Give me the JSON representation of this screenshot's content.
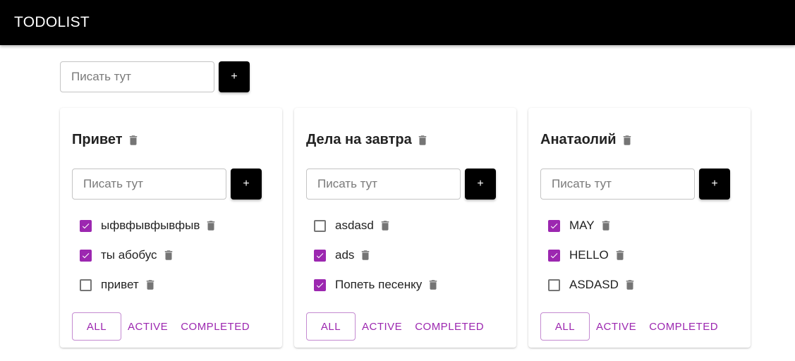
{
  "app": {
    "title": "TODOLIST"
  },
  "add_list": {
    "placeholder": "Писать тут",
    "button_label": "+"
  },
  "colors": {
    "accent": "#9c27b0",
    "appbar": "#000000",
    "icon_gray": "#757575"
  },
  "lists": [
    {
      "title": "Привет",
      "input_placeholder": "Писать тут",
      "add_label": "+",
      "tasks": [
        {
          "text": "ыфвфывфывфыв",
          "done": true
        },
        {
          "text": "ты абобус",
          "done": true
        },
        {
          "text": "привет",
          "done": false
        }
      ],
      "filters": {
        "all": "ALL",
        "active": "ACTIVE",
        "completed": "COMPLETED",
        "selected": "all"
      }
    },
    {
      "title": "Дела на завтра",
      "input_placeholder": "Писать тут",
      "add_label": "+",
      "tasks": [
        {
          "text": "asdasd",
          "done": false
        },
        {
          "text": "ads",
          "done": true
        },
        {
          "text": "Попеть песенку",
          "done": true
        }
      ],
      "filters": {
        "all": "ALL",
        "active": "ACTIVE",
        "completed": "COMPLETED",
        "selected": "all"
      }
    },
    {
      "title": "Анатаолий",
      "input_placeholder": "Писать тут",
      "add_label": "+",
      "tasks": [
        {
          "text": "MAY",
          "done": true
        },
        {
          "text": "HELLO",
          "done": true
        },
        {
          "text": "ASDASD",
          "done": false
        }
      ],
      "filters": {
        "all": "ALL",
        "active": "ACTIVE",
        "completed": "COMPLETED",
        "selected": "all"
      }
    }
  ]
}
